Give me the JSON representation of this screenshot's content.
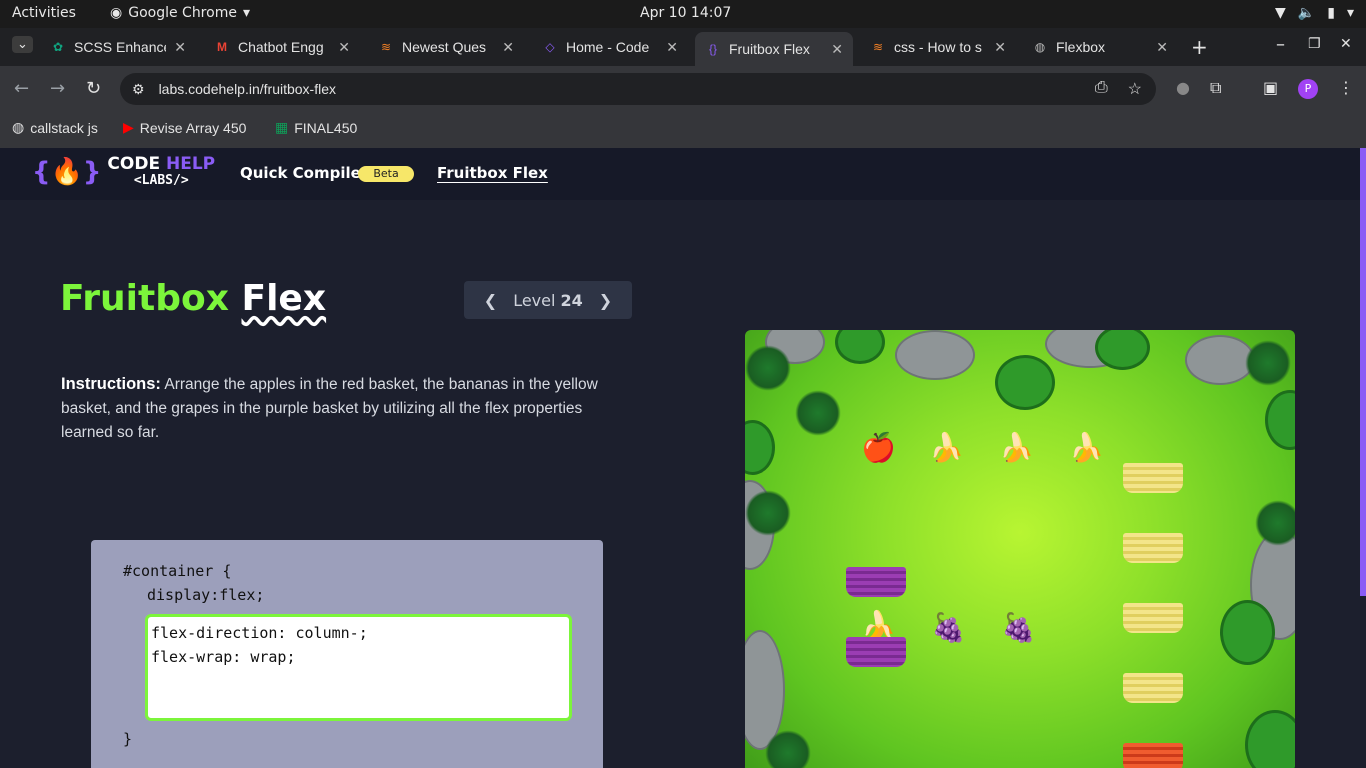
{
  "system": {
    "activities": "Activities",
    "app_name": "Google Chrome",
    "clock": "Apr 10  14:07"
  },
  "tabs": [
    {
      "title": "SCSS Enhance",
      "icon": "openai-icon"
    },
    {
      "title": "Chatbot Engg",
      "icon": "gmail-icon"
    },
    {
      "title": "Newest Ques",
      "icon": "stackoverflow-icon"
    },
    {
      "title": "Home - Code",
      "icon": "codehelp-icon"
    },
    {
      "title": "Fruitbox Flex",
      "icon": "codehelp-icon",
      "active": true
    },
    {
      "title": "css - How to s",
      "icon": "stackoverflow-icon"
    },
    {
      "title": "Flexbox",
      "icon": "globe-icon"
    }
  ],
  "browser": {
    "url": "labs.codehelp.in/fruitbox-flex"
  },
  "bookmarks": [
    {
      "label": "callstack js",
      "icon": "globe-icon"
    },
    {
      "label": "Revise Array 450",
      "icon": "youtube-icon"
    },
    {
      "label": "FINAL450",
      "icon": "sheets-icon"
    }
  ],
  "site": {
    "logo_line1a": "CODE",
    "logo_line1b": " HELP",
    "logo_line2": "<LABS/>",
    "nav_compiler": "Quick Compiler",
    "nav_beta": "Beta",
    "nav_fruitbox": "Fruitbox Flex"
  },
  "main": {
    "title_green": "Fruitbox",
    "title_white": "Flex",
    "level_label": "Level",
    "level_number": "24",
    "instructions_label": "Instructions:",
    "instructions_text": " Arrange the apples in the red basket, the bananas in the yellow basket, and the grapes in the purple basket by utilizing all the flex properties learned so far."
  },
  "editor": {
    "line1": "#container {",
    "line2": "display:flex;",
    "user_css": "flex-direction: column-;\nflex-wrap: wrap;",
    "closing": "}"
  },
  "colors": {
    "accent_green": "#7cf53b",
    "accent_purple": "#8a5cf5",
    "beta_yellow": "#f7e769"
  }
}
